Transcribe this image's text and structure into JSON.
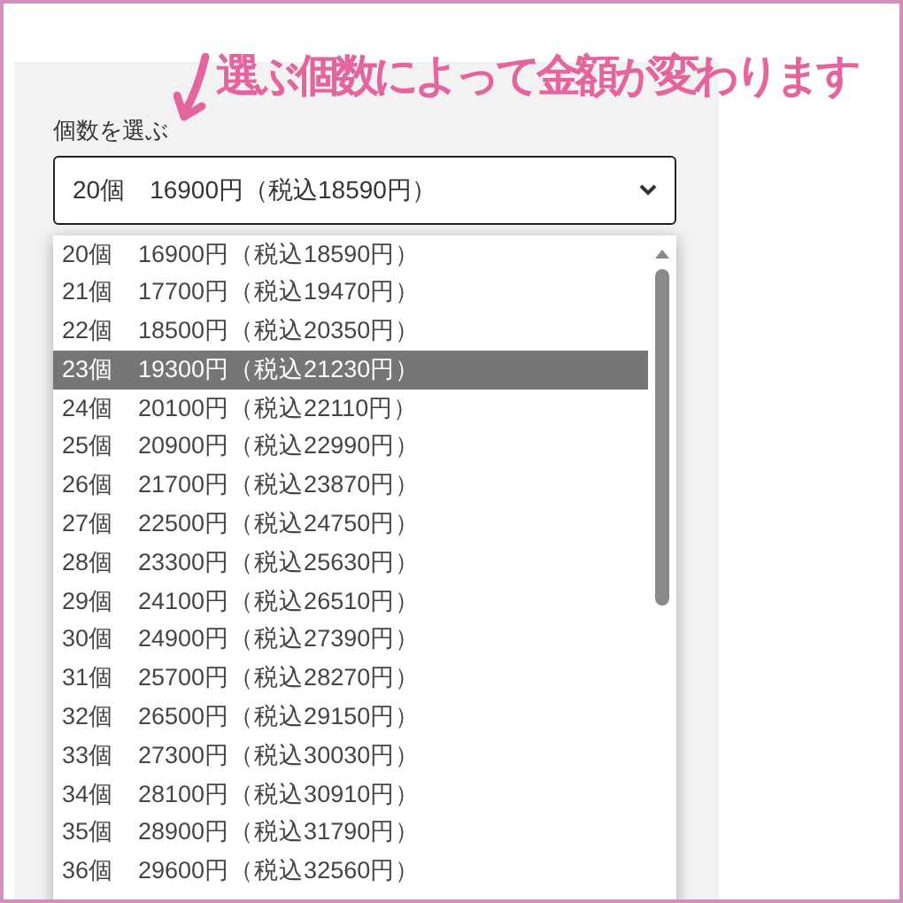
{
  "annotation": {
    "text": "選ぶ個数によって金額が変わります"
  },
  "field_label": "個数を選ぶ",
  "select": {
    "value": "20個　16900円（税込18590円）",
    "expanded": true
  },
  "options": [
    {
      "label": "20個　16900円（税込18590円）",
      "selected": false
    },
    {
      "label": "21個　17700円（税込19470円）",
      "selected": false
    },
    {
      "label": "22個　18500円（税込20350円）",
      "selected": false
    },
    {
      "label": "23個　19300円（税込21230円）",
      "selected": true
    },
    {
      "label": "24個　20100円（税込22110円）",
      "selected": false
    },
    {
      "label": "25個　20900円（税込22990円）",
      "selected": false
    },
    {
      "label": "26個　21700円（税込23870円）",
      "selected": false
    },
    {
      "label": "27個　22500円（税込24750円）",
      "selected": false
    },
    {
      "label": "28個　23300円（税込25630円）",
      "selected": false
    },
    {
      "label": "29個　24100円（税込26510円）",
      "selected": false
    },
    {
      "label": "30個　24900円（税込27390円）",
      "selected": false
    },
    {
      "label": "31個　25700円（税込28270円）",
      "selected": false
    },
    {
      "label": "32個　26500円（税込29150円）",
      "selected": false
    },
    {
      "label": "33個　27300円（税込30030円）",
      "selected": false
    },
    {
      "label": "34個　28100円（税込30910円）",
      "selected": false
    },
    {
      "label": "35個　28900円（税込31790円）",
      "selected": false
    },
    {
      "label": "36個　29600円（税込32560円）",
      "selected": false
    }
  ]
}
